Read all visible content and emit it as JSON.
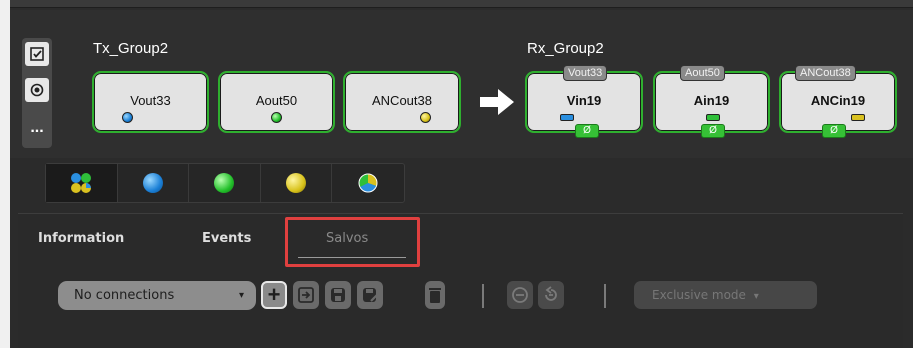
{
  "tx_group": {
    "title": "Tx_Group2",
    "items": [
      {
        "label": "Vout33",
        "ball": "blue"
      },
      {
        "label": "Aout50",
        "ball": "green"
      },
      {
        "label": "ANCout38",
        "ball": "yellow"
      }
    ]
  },
  "rx_group": {
    "title": "Rx_Group2",
    "items": [
      {
        "label": "Vin19",
        "source_tag": "Vout33",
        "chip": "blue",
        "badge": "Ø"
      },
      {
        "label": "Ain19",
        "source_tag": "Aout50",
        "chip": "green",
        "badge": "Ø"
      },
      {
        "label": "ANCin19",
        "source_tag": "ANCout38",
        "chip": "yellow",
        "badge": "Ø"
      }
    ]
  },
  "side_toolbar": {
    "more_label": "..."
  },
  "filter_bar": {
    "buttons": [
      "all-icon",
      "video-icon",
      "audio-icon",
      "ancillary-icon",
      "mixed-icon"
    ],
    "active": "all-icon"
  },
  "tabs": [
    {
      "label": "Information"
    },
    {
      "label": "Events"
    },
    {
      "label": "Salvos"
    }
  ],
  "salvos_toolbar": {
    "dropdown_value": "No connections",
    "dropdown_caret": "▾",
    "add_label": "+",
    "exclusive_mode_label": "Exclusive mode",
    "exclusive_caret": "▾"
  },
  "colors": {
    "card_border": "#2fb02f",
    "highlight": "#e0403f",
    "background": "#2b2b2b"
  }
}
